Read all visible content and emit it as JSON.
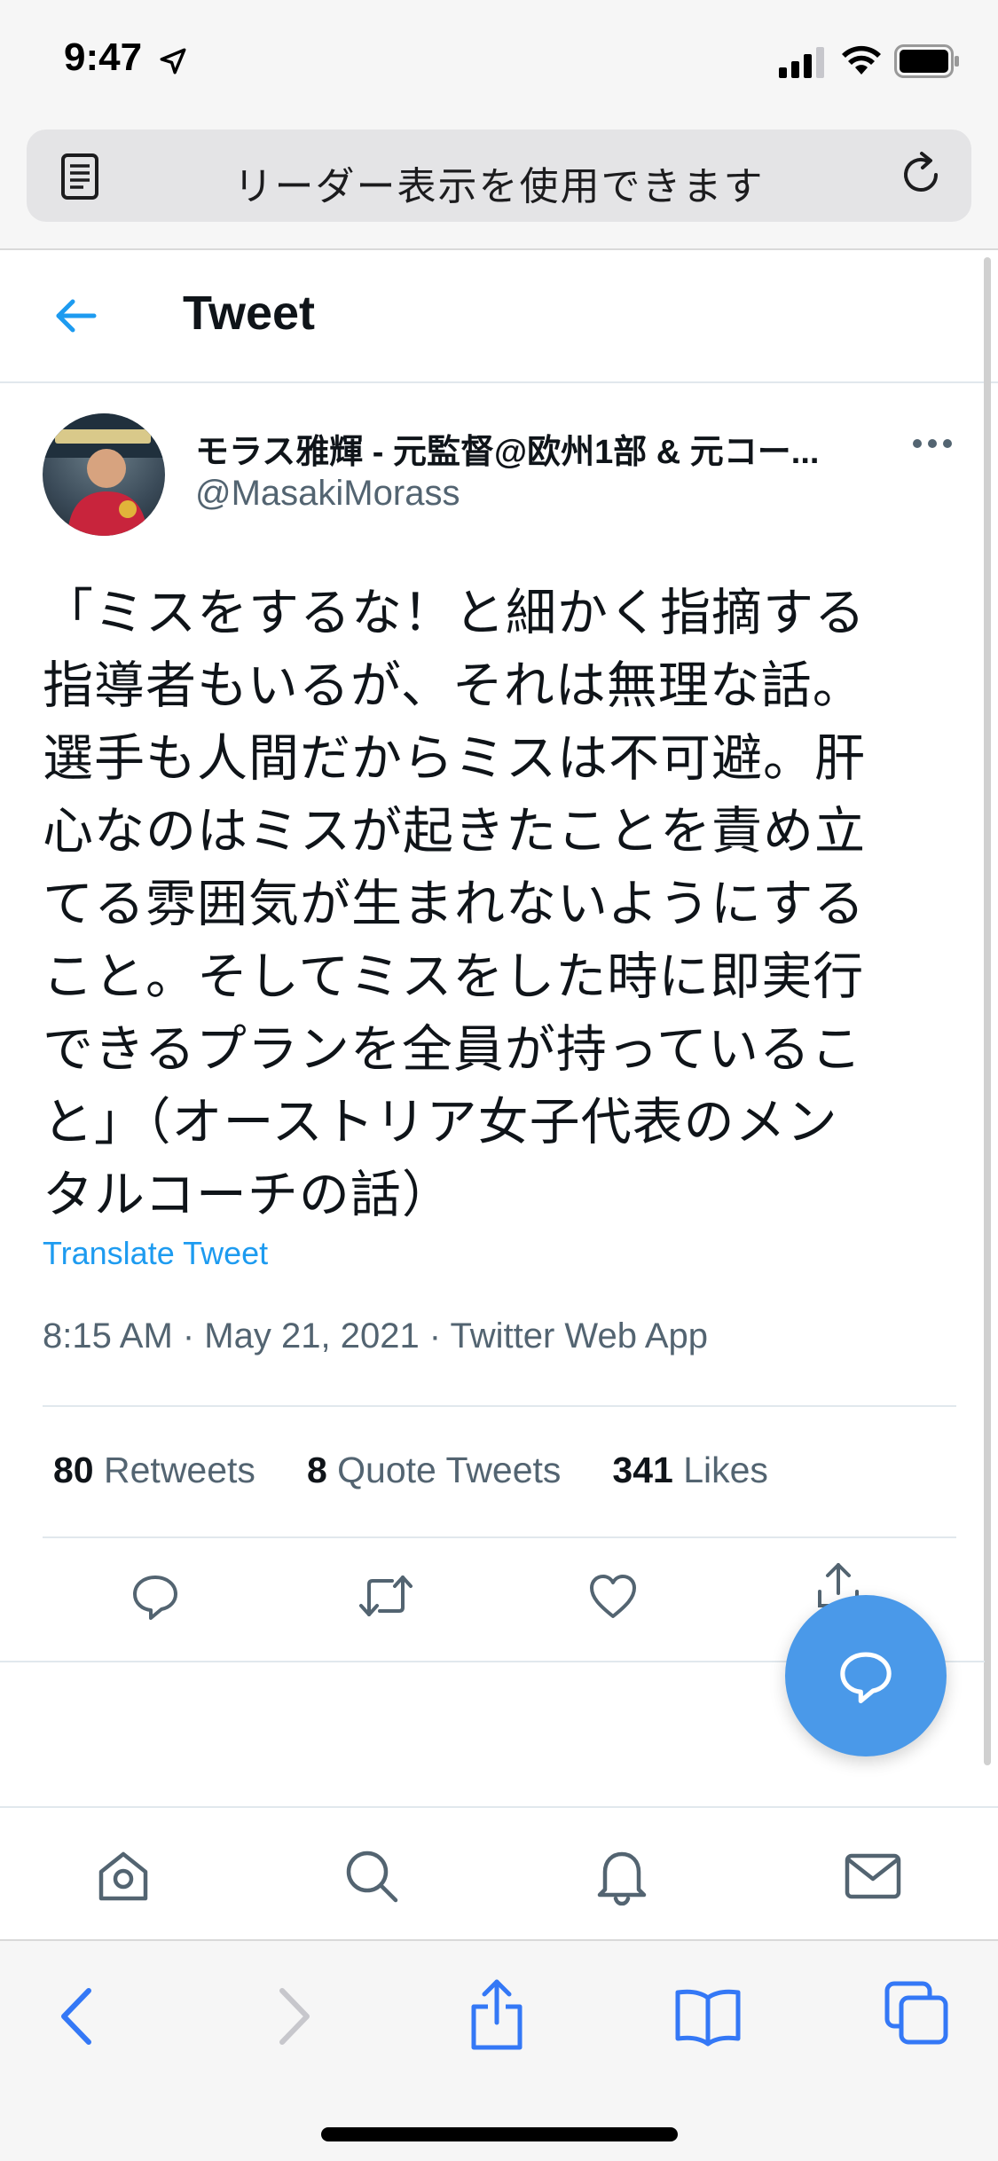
{
  "status_bar": {
    "time": "9:47",
    "icons": [
      "location-arrow-icon",
      "signal-icon",
      "wifi-icon",
      "battery-icon"
    ]
  },
  "safari": {
    "address_text": "リーダー表示を使用できます",
    "toolbar_icons": [
      "back-icon",
      "forward-icon",
      "share-icon",
      "bookmarks-icon",
      "tabs-icon"
    ]
  },
  "header": {
    "title": "Tweet"
  },
  "tweet": {
    "author_name": "モラス雅輝 - 元監督@欧州1部 & 元コー...",
    "author_handle": "@MasakiMorass",
    "text": "「ミスをするな！と細かく指摘する\n指導者もいるが、それは無理な話。\n選手も人間だからミスは不可避。肝\n心なのはミスが起きたことを責め立\nてる雰囲気が生まれないようにする\nこと。そしてミスをした時に即実行\nできるプランを全員が持っているこ\nと」（オーストリア女子代表のメン\nタルコーチの話）",
    "translate_label": "Translate Tweet",
    "timestamp": "8:15 AM · May 21, 2021 · Twitter Web App",
    "stats": {
      "retweets_count": "80",
      "retweets_label": "Retweets",
      "quotes_count": "8",
      "quotes_label": "Quote Tweets",
      "likes_count": "341",
      "likes_label": "Likes"
    }
  },
  "bottom_nav": [
    "home-icon",
    "search-icon",
    "notifications-icon",
    "messages-icon"
  ],
  "colors": {
    "accent": "#1d9bf0",
    "fab": "#4a99e9",
    "text": "#0f1419",
    "secondary": "#536471"
  }
}
